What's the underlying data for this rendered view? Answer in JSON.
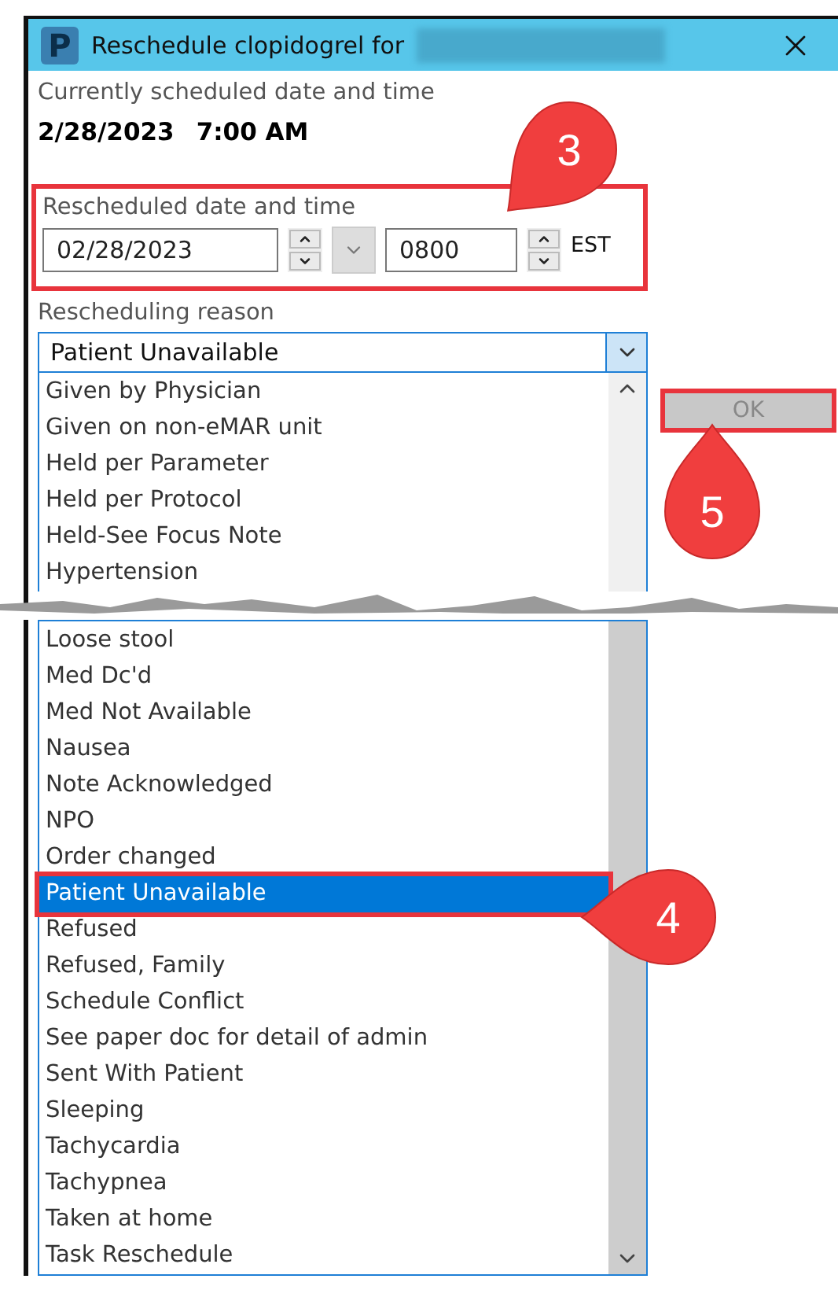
{
  "window": {
    "icon_letter": "P",
    "title": "Reschedule clopidogrel for",
    "name_redacted": true
  },
  "current": {
    "label": "Currently scheduled date and time",
    "date": "2/28/2023",
    "time": "7:00 AM"
  },
  "rescheduled": {
    "label": "Rescheduled date and time",
    "highlighted": true,
    "date": "02/28/2023",
    "time": "0800",
    "timezone": "EST"
  },
  "reason": {
    "label": "Rescheduling reason",
    "value": "Patient Unavailable",
    "highlight_selected": true,
    "options_top": [
      {
        "label": "Given by Physician",
        "selected": false
      },
      {
        "label": "Given on non-eMAR unit",
        "selected": false
      },
      {
        "label": "Held per Parameter",
        "selected": false
      },
      {
        "label": "Held per Protocol",
        "selected": false
      },
      {
        "label": "Held-See Focus Note",
        "selected": false
      },
      {
        "label": "Hypertension",
        "selected": false
      }
    ],
    "options_bottom": [
      {
        "label": "Loose stool",
        "selected": false
      },
      {
        "label": "Med Dc'd",
        "selected": false
      },
      {
        "label": "Med Not Available",
        "selected": false
      },
      {
        "label": "Nausea",
        "selected": false
      },
      {
        "label": "Note Acknowledged",
        "selected": false
      },
      {
        "label": "NPO",
        "selected": false
      },
      {
        "label": "Order changed",
        "selected": false
      },
      {
        "label": "Patient Unavailable",
        "selected": true
      },
      {
        "label": "Refused",
        "selected": false
      },
      {
        "label": "Refused, Family",
        "selected": false
      },
      {
        "label": "Schedule Conflict",
        "selected": false
      },
      {
        "label": "See paper doc for detail of admin",
        "selected": false
      },
      {
        "label": "Sent With Patient",
        "selected": false
      },
      {
        "label": "Sleeping",
        "selected": false
      },
      {
        "label": "Tachycardia",
        "selected": false
      },
      {
        "label": "Tachypnea",
        "selected": false
      },
      {
        "label": "Taken at home",
        "selected": false
      },
      {
        "label": "Task Reschedule",
        "selected": false
      }
    ]
  },
  "ok_button": {
    "label": "OK",
    "disabled": true,
    "highlighted": true
  },
  "callouts": [
    {
      "label": "3",
      "kind": "fields"
    },
    {
      "label": "5",
      "kind": "button"
    },
    {
      "label": "4",
      "kind": "item"
    }
  ]
}
